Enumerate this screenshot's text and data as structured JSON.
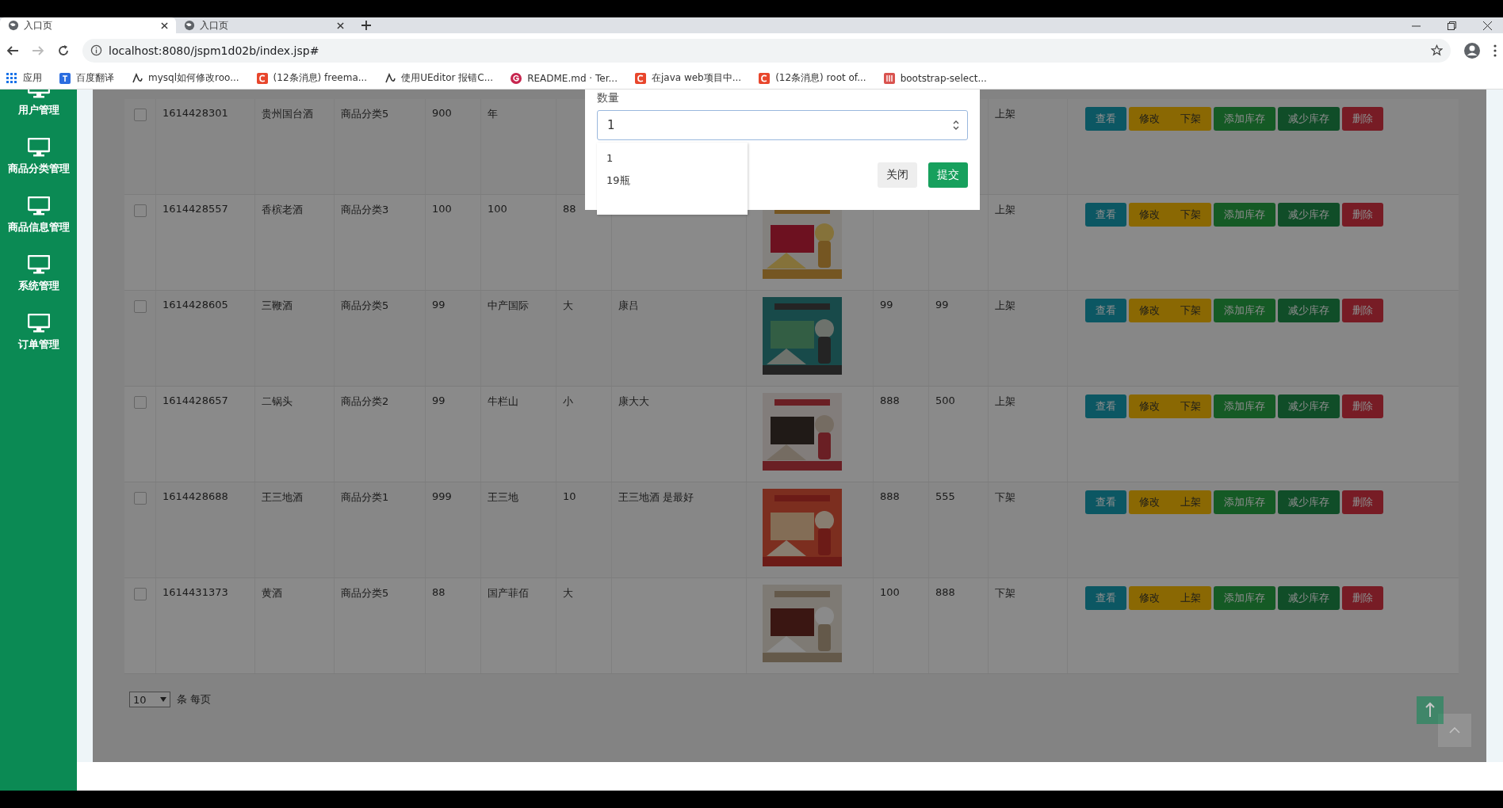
{
  "browser": {
    "tabs": [
      {
        "title": "入口页",
        "selected": true
      },
      {
        "title": "入口页",
        "selected": false
      }
    ],
    "url": "localhost:8080/jspm1d02b/index.jsp#",
    "bookmarks": [
      {
        "label": "应用",
        "kind": "apps"
      },
      {
        "label": "百度翻译",
        "kind": "translate"
      },
      {
        "label": "mysql如何修改roo...",
        "kind": "link"
      },
      {
        "label": "(12条消息) freema...",
        "kind": "csdn"
      },
      {
        "label": "使用UEditor 报错C...",
        "kind": "link"
      },
      {
        "label": "README.md · Ter...",
        "kind": "github"
      },
      {
        "label": "在java web项目中...",
        "kind": "csdn"
      },
      {
        "label": "(12条消息) root of...",
        "kind": "csdn"
      },
      {
        "label": "bootstrap-select...",
        "kind": "bootstrap"
      }
    ]
  },
  "sidebar": {
    "items": [
      {
        "label": "用户管理"
      },
      {
        "label": "商品分类管理"
      },
      {
        "label": "商品信息管理"
      },
      {
        "label": "系统管理"
      },
      {
        "label": "订单管理"
      }
    ]
  },
  "table": {
    "rows": [
      {
        "checked": false,
        "cells": {
          "column_2": "1614428301",
          "column_3": "贵州国台酒",
          "column_4": "商品分类5",
          "column_5": "900",
          "column_6": "年",
          "column_12": "上架"
        },
        "actions": [
          {
            "kind": "view",
            "label": "查看"
          },
          {
            "kind": "edit",
            "label": "修改"
          },
          {
            "kind": "toggle",
            "label": "下架"
          },
          {
            "kind": "add",
            "label": "添加库存"
          },
          {
            "kind": "reduce",
            "label": "减少库存"
          },
          {
            "kind": "delete",
            "label": "删除"
          }
        ]
      },
      {
        "checked": false,
        "cells": {
          "column_2": "1614428557",
          "column_3": "香槟老酒",
          "column_4": "商品分类3",
          "column_5": "100",
          "column_6": "100",
          "column_7": "88",
          "column_12": "上架"
        },
        "actions": [
          {
            "kind": "view",
            "label": "查看"
          },
          {
            "kind": "edit",
            "label": "修改"
          },
          {
            "kind": "toggle",
            "label": "下架"
          },
          {
            "kind": "add",
            "label": "添加库存"
          },
          {
            "kind": "reduce",
            "label": "减少库存"
          },
          {
            "kind": "delete",
            "label": "删除"
          }
        ]
      },
      {
        "checked": false,
        "cells": {
          "column_2": "1614428605",
          "column_3": "三鞭酒",
          "column_4": "商品分类5",
          "column_5": "99",
          "column_6": "中产国际",
          "column_7": "大",
          "column_8": "康吕",
          "column_10": "99",
          "column_11": "99",
          "column_12": "上架"
        },
        "actions": [
          {
            "kind": "view",
            "label": "查看"
          },
          {
            "kind": "edit",
            "label": "修改"
          },
          {
            "kind": "toggle",
            "label": "下架"
          },
          {
            "kind": "add",
            "label": "添加库存"
          },
          {
            "kind": "reduce",
            "label": "减少库存"
          },
          {
            "kind": "delete",
            "label": "删除"
          }
        ]
      },
      {
        "checked": false,
        "cells": {
          "column_2": "1614428657",
          "column_3": "二锅头",
          "column_4": "商品分类2",
          "column_5": "99",
          "column_6": "牛栏山",
          "column_7": "小",
          "column_8": "康大大",
          "column_10": "888",
          "column_11": "500",
          "column_12": "上架"
        },
        "actions": [
          {
            "kind": "view",
            "label": "查看"
          },
          {
            "kind": "edit",
            "label": "修改"
          },
          {
            "kind": "toggle",
            "label": "下架"
          },
          {
            "kind": "add",
            "label": "添加库存"
          },
          {
            "kind": "reduce",
            "label": "减少库存"
          },
          {
            "kind": "delete",
            "label": "删除"
          }
        ]
      },
      {
        "checked": false,
        "cells": {
          "column_2": "1614428688",
          "column_3": "王三地酒",
          "column_4": "商品分类1",
          "column_5": "999",
          "column_6": "王三地",
          "column_7": "10",
          "column_8": "王三地酒 是最好",
          "column_10": "888",
          "column_11": "555",
          "column_12": "下架"
        },
        "actions": [
          {
            "kind": "view",
            "label": "查看"
          },
          {
            "kind": "edit",
            "label": "修改"
          },
          {
            "kind": "toggle",
            "label": "上架"
          },
          {
            "kind": "add",
            "label": "添加库存"
          },
          {
            "kind": "reduce",
            "label": "减少库存"
          },
          {
            "kind": "delete",
            "label": "删除"
          }
        ]
      },
      {
        "checked": false,
        "cells": {
          "column_2": "1614431373",
          "column_3": "黄酒",
          "column_4": "商品分类5",
          "column_5": "88",
          "column_6": "国产菲佰",
          "column_7": "大",
          "column_10": "100",
          "column_11": "888",
          "column_12": "下架"
        },
        "actions": [
          {
            "kind": "view",
            "label": "查看"
          },
          {
            "kind": "edit",
            "label": "修改"
          },
          {
            "kind": "toggle",
            "label": "上架"
          },
          {
            "kind": "add",
            "label": "添加库存"
          },
          {
            "kind": "reduce",
            "label": "减少库存"
          },
          {
            "kind": "delete",
            "label": "删除"
          }
        ]
      }
    ]
  },
  "pagination": {
    "page_size": "10",
    "suffix": "条 每页"
  },
  "modal": {
    "label": "数量",
    "value": "1",
    "suggestions": [
      "1",
      "19瓶"
    ],
    "buttons": [
      {
        "kind": "secondary",
        "label": "关闭"
      },
      {
        "kind": "primary",
        "label": "提交"
      }
    ]
  }
}
